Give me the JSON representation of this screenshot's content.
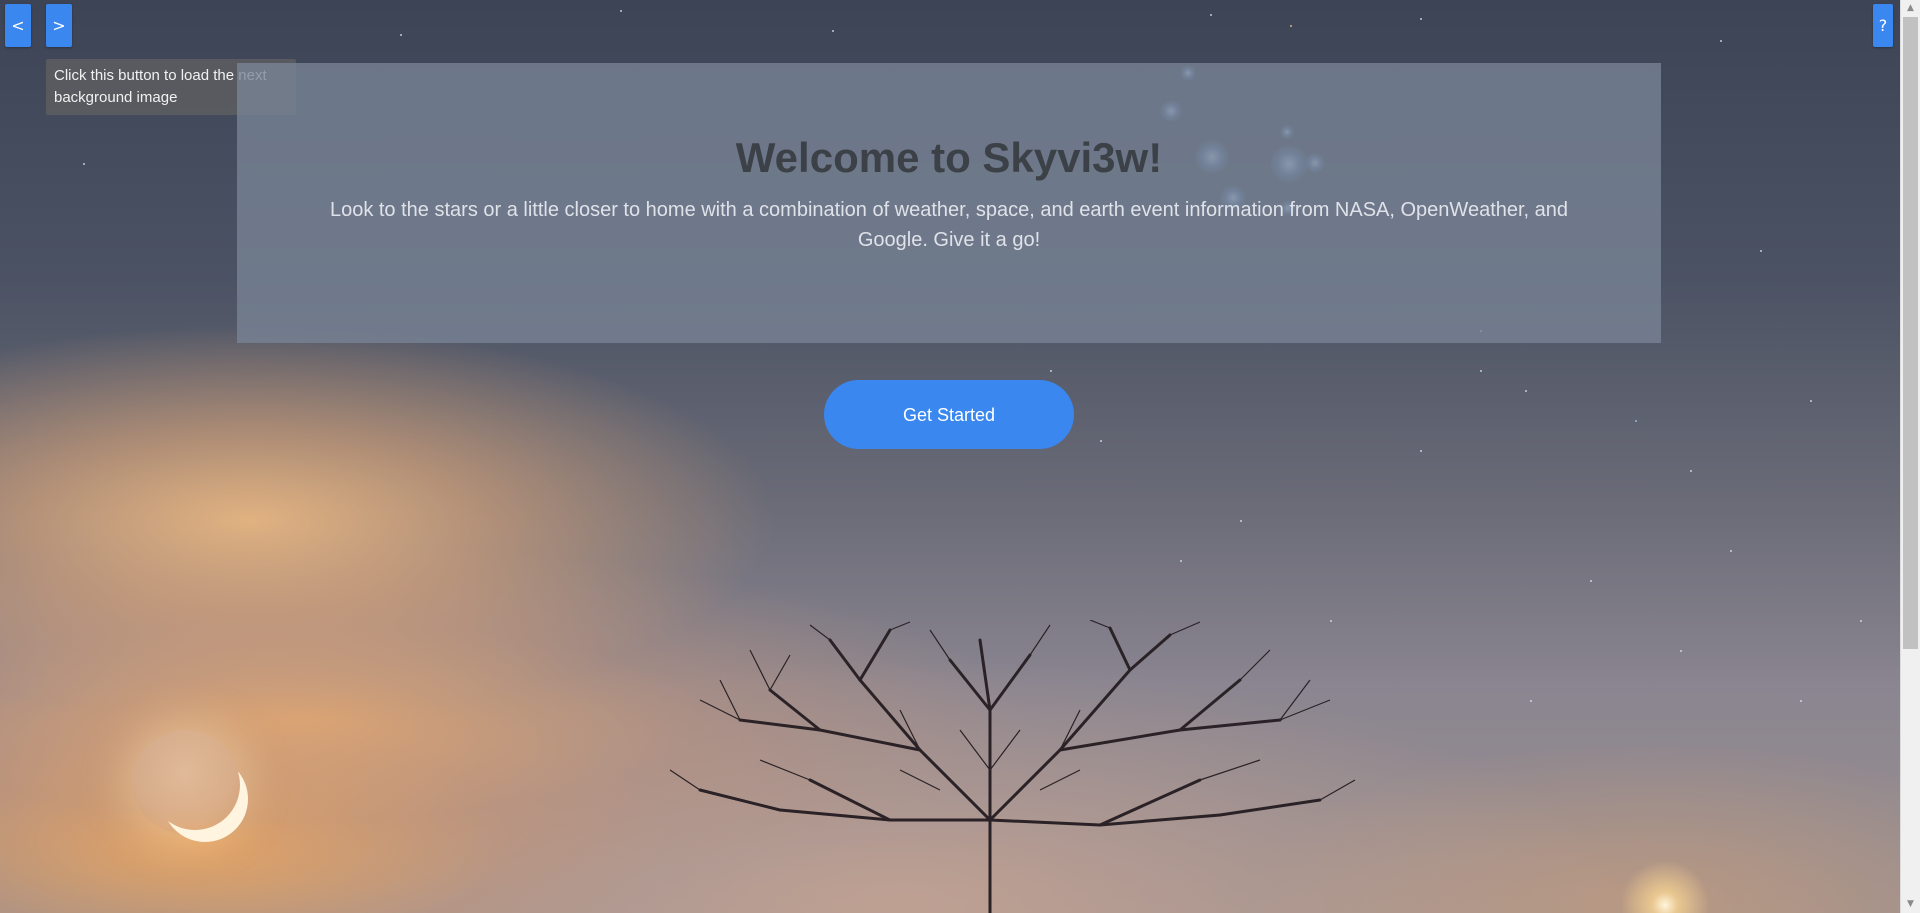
{
  "nav": {
    "prev_label": "<",
    "next_label": ">",
    "help_label": "?"
  },
  "tooltip": {
    "text": "Click this button to load the next background image"
  },
  "hero": {
    "title": "Welcome to Skyvi3w!",
    "description": "Look to the stars or a little closer to home with a combination of weather, space, and earth event information from NASA, OpenWeather, and Google. Give it a go!"
  },
  "cta": {
    "label": "Get Started"
  },
  "colors": {
    "accent": "#3a87f0",
    "hero_overlay": "#788496",
    "title": "#3c4047"
  },
  "icons": {
    "prev": "chevron-left-icon",
    "next": "chevron-right-icon",
    "help": "question-icon",
    "scroll_up": "triangle-up-icon",
    "scroll_down": "triangle-down-icon"
  }
}
